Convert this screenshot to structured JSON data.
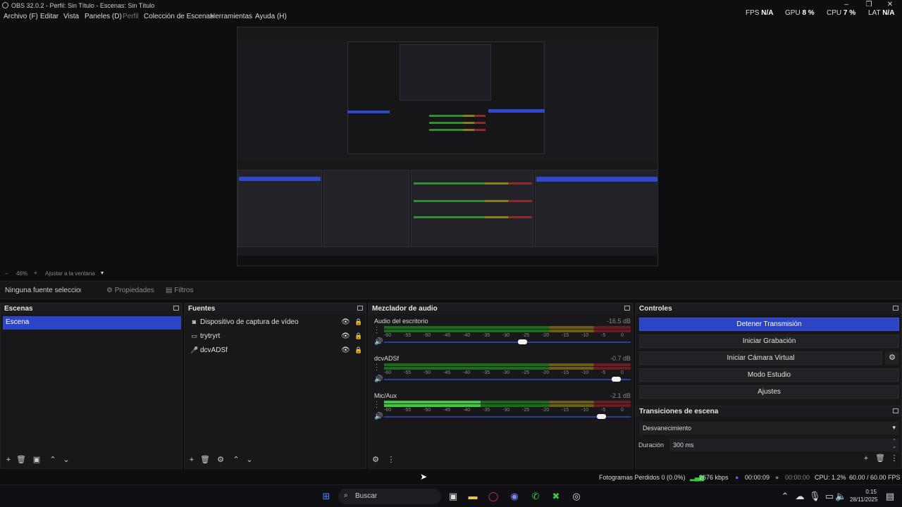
{
  "window": {
    "title": "OBS 32.0.2 - Perfil: Sin Título - Escenas: Sin Título"
  },
  "menu": [
    {
      "label": "Archivo (F)"
    },
    {
      "label": "Editar"
    },
    {
      "label": "Vista"
    },
    {
      "label": "Paneles (D)"
    },
    {
      "label": "Perfil"
    },
    {
      "label": "Colección de Escenas"
    },
    {
      "label": "Herramientas"
    },
    {
      "label": "Ayuda (H)"
    }
  ],
  "stats": {
    "fps_label": "FPS",
    "fps_value": "N/A",
    "gpu_label": "GPU",
    "gpu_value": "8 %",
    "cpu_label": "CPU",
    "cpu_value": "7 %",
    "lat_label": "LAT",
    "lat_value": "N/A"
  },
  "zoom": {
    "minus": "−",
    "value": "46%",
    "plus": "+",
    "fit": "Ajustar a la ventana",
    "arrow": "▾"
  },
  "source_toolbar": {
    "no_source": "Ninguna fuente seleccionada",
    "properties": "Propiedades",
    "filters": "Filtros"
  },
  "scenes": {
    "title": "Escenas",
    "items": [
      "Escena"
    ]
  },
  "sources": {
    "title": "Fuentes",
    "items": [
      {
        "name": "Dispositivo de captura de vídeo",
        "icon": "camera-icon",
        "glyph": "◙"
      },
      {
        "name": "trytryrt",
        "icon": "monitor-icon",
        "glyph": "▭"
      },
      {
        "name": "dcvADSf",
        "icon": "microphone-icon",
        "glyph": "🎤"
      }
    ]
  },
  "mixer": {
    "title": "Mezclador de audio",
    "ticks": [
      "-60",
      "-55",
      "-50",
      "-45",
      "-40",
      "-35",
      "-30",
      "-25",
      "-20",
      "-15",
      "-10",
      "-5",
      "0"
    ],
    "channels": [
      {
        "name": "Audio del escritorio",
        "db": "-16.5 dB",
        "level": 0,
        "volume": 0.56
      },
      {
        "name": "dcvADSf",
        "db": "-0.7 dB",
        "level": 0,
        "volume": 0.94
      },
      {
        "name": "Mic/Aux",
        "db": "-2.1 dB",
        "level": 0.39,
        "volume": 0.88
      }
    ]
  },
  "controls": {
    "title": "Controles",
    "stop_stream": "Detener Transmisión",
    "start_recording": "Iniciar Grabación",
    "start_virtual_cam": "Iniciar Cámara Virtual",
    "studio_mode": "Modo Estudio",
    "settings": "Ajustes"
  },
  "transitions": {
    "title": "Transiciones de escena",
    "selected": "Desvanecimiento",
    "duration_label": "Duración",
    "duration_value": "300 ms"
  },
  "status": {
    "dropped": "Fotogramas Perdidos 0 (0.0%)",
    "bitrate": "2676 kbps",
    "stream_time": "00:00:09",
    "rec_time": "00:00:00",
    "cpu": "CPU: 1.2%",
    "fps": "60.00 / 60.00 FPS"
  },
  "taskbar": {
    "search_label": "Buscar",
    "time": "0:15",
    "date": "28/11/2025"
  }
}
